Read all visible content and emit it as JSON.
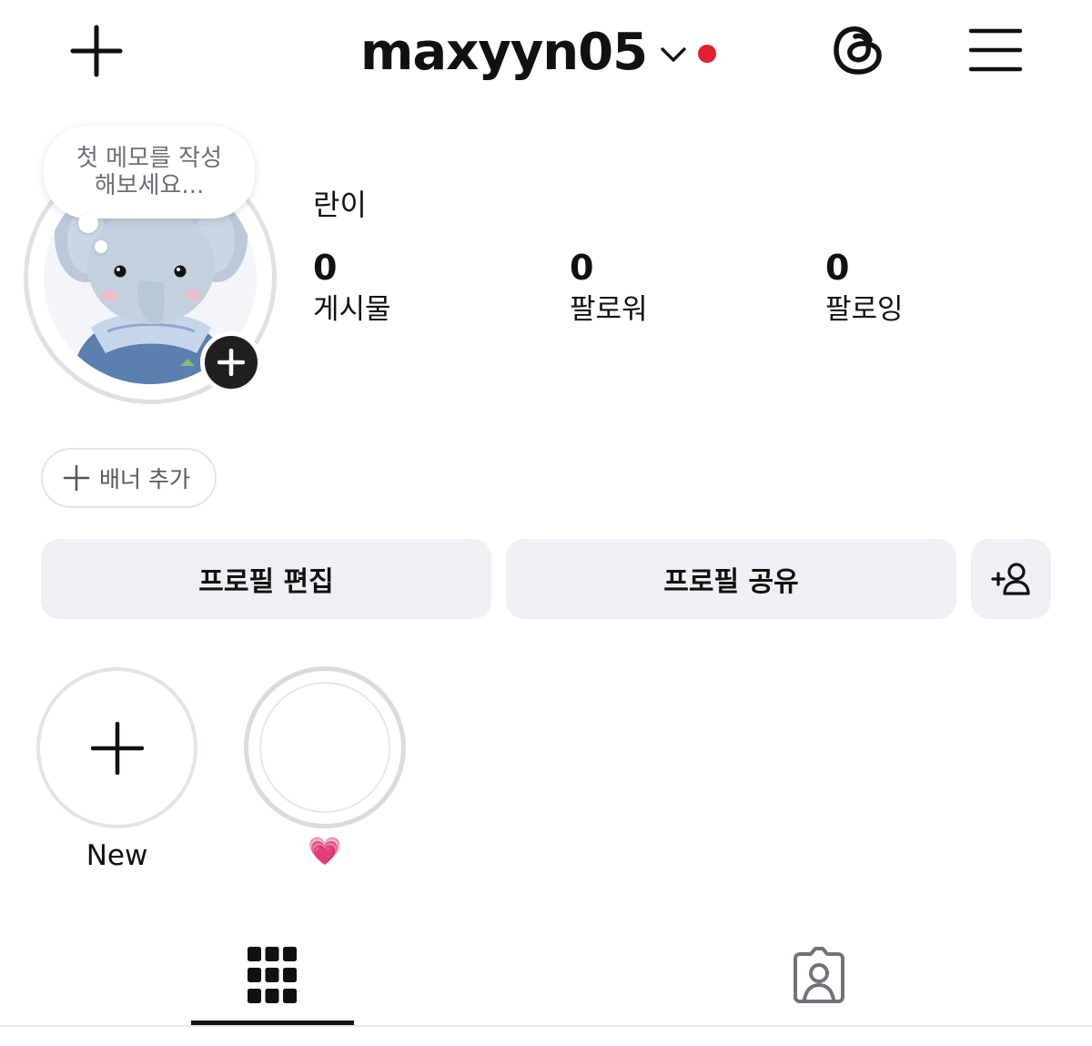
{
  "header": {
    "username": "maxyyn05",
    "icons": {
      "create": "plus-icon",
      "account_switch": "chevron-down-icon",
      "notification": "red-dot",
      "threads": "threads-icon",
      "menu": "hamburger-menu-icon"
    }
  },
  "note": {
    "text": "첫 메모를 작성 해보세요..."
  },
  "profile": {
    "display_name": "란이",
    "stats": [
      {
        "value": "0",
        "label": "게시물"
      },
      {
        "value": "0",
        "label": "팔로워"
      },
      {
        "value": "0",
        "label": "팔로잉"
      }
    ]
  },
  "banner": {
    "label": "배너 추가"
  },
  "actions": {
    "edit_profile": "프로필 편집",
    "share_profile": "프로필 공유",
    "discover_people_icon": "person-add-icon"
  },
  "highlights": [
    {
      "label": "New",
      "icon": "plus-icon"
    },
    {
      "label": "💗",
      "icon": "empty-cover"
    }
  ],
  "tabs": [
    {
      "name": "posts-grid",
      "icon": "grid-icon",
      "active": true
    },
    {
      "name": "tagged",
      "icon": "tagged-person-icon",
      "active": false
    }
  ],
  "colors": {
    "notification_dot": "#e5202e",
    "button_bg": "#eff0f3",
    "ring": "#dfe1e5",
    "text": "#111111"
  }
}
